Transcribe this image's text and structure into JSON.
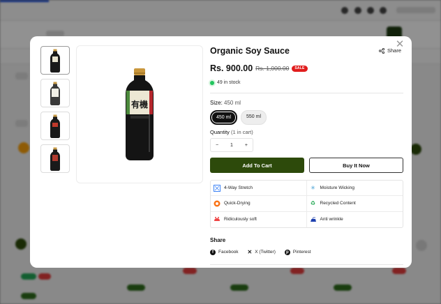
{
  "product": {
    "title": "Organic Soy Sauce",
    "price": "Rs. 900.00",
    "old_price": "Rs. 1,000.00",
    "sale_badge": "SALE",
    "stock": "49 in stock",
    "bottle_label": "有機"
  },
  "header": {
    "share_label": "Share"
  },
  "size": {
    "label": "Size:",
    "selected": "450 ml",
    "options": [
      "450 ml",
      "550 ml"
    ]
  },
  "quantity": {
    "label": "Quantity",
    "in_cart": "(1 in cart)",
    "value": "1",
    "minus": "−",
    "plus": "+"
  },
  "actions": {
    "add_to_cart": "Add To Cart",
    "buy_now": "Buy It Now"
  },
  "features": [
    {
      "label": "4-Way Stretch",
      "icon": "stretch-icon"
    },
    {
      "label": "Moisture Wicking",
      "icon": "moisture-icon"
    },
    {
      "label": "Quick-Drying",
      "icon": "quick-dry-icon"
    },
    {
      "label": "Recycled Content",
      "icon": "recycle-icon"
    },
    {
      "label": "Ridiculously soft",
      "icon": "soft-icon"
    },
    {
      "label": "Anti wrinkle",
      "icon": "iron-icon"
    }
  ],
  "share": {
    "heading": "Share",
    "links": [
      {
        "label": "Facebook",
        "icon": "facebook-icon"
      },
      {
        "label": "X (Twitter)",
        "icon": "x-icon"
      },
      {
        "label": "Pinterest",
        "icon": "pinterest-icon"
      }
    ]
  },
  "colors": {
    "primary": "#2d4a0b",
    "sale": "#e11d1d",
    "stock": "#22c55e"
  }
}
